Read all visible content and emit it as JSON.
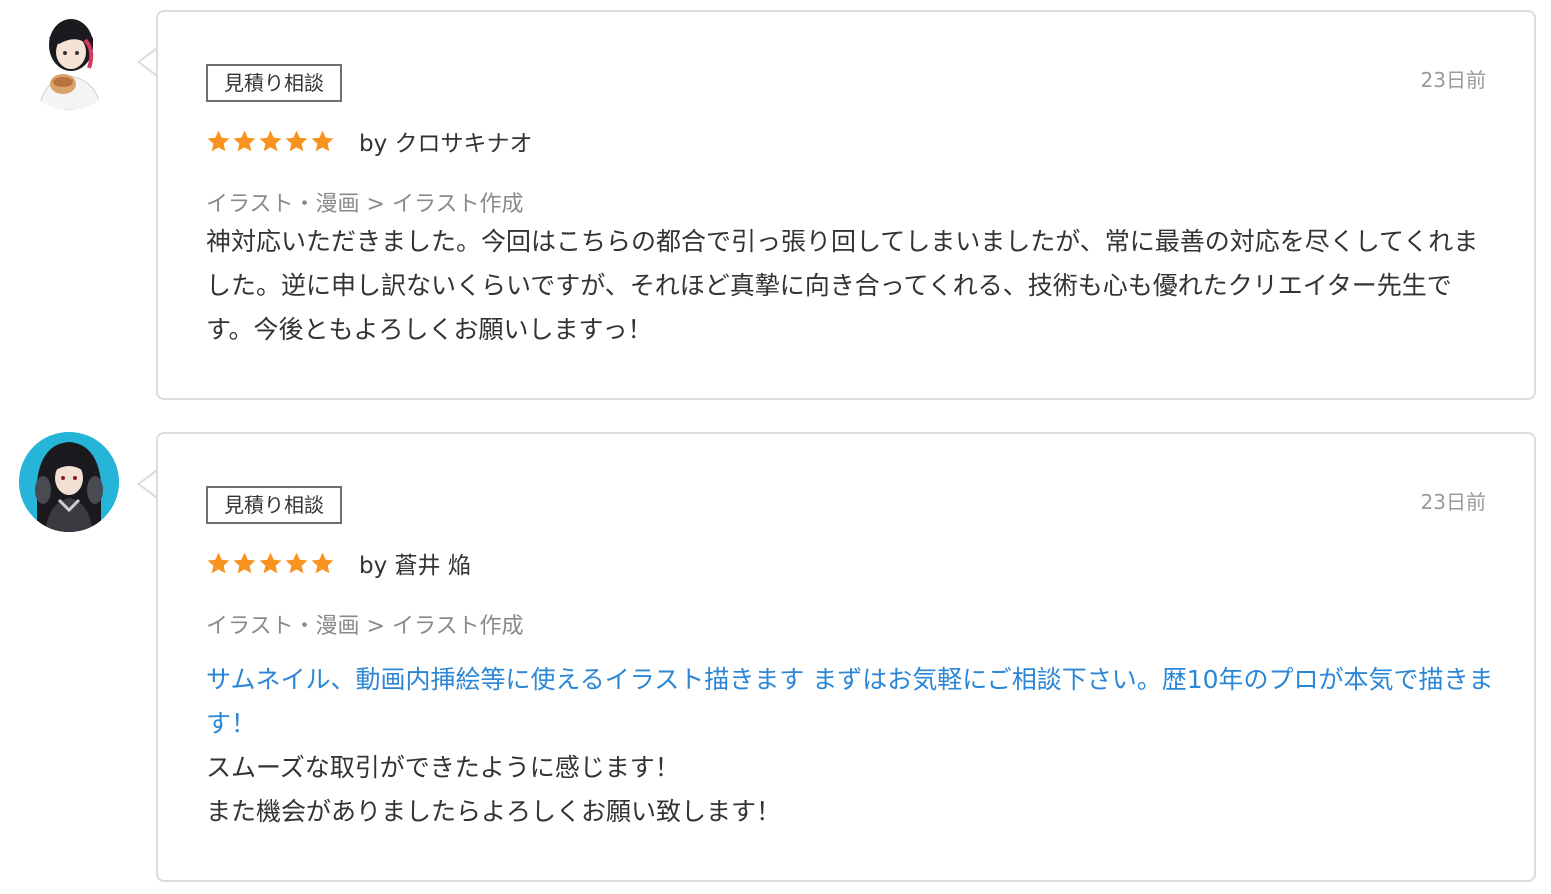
{
  "reviews": [
    {
      "tag": "見積り相談",
      "date": "23日前",
      "rating": 5,
      "byline": "by クロサキナオ",
      "category": "イラスト・漫画 > イラスト作成",
      "service_link": "",
      "comment": "神対応いただきました。今回はこちらの都合で引っ張り回してしまいましたが、常に最善の対応を尽くしてくれました。逆に申し訳ないくらいですが、それほど真摯に向き合ってくれる、技術も心も優れたクリエイター先生です。今後ともよろしくお願いしますっ！",
      "star_color": "#f7931e"
    },
    {
      "tag": "見積り相談",
      "date": "23日前",
      "rating": 5,
      "byline": "by 蒼井 焔",
      "category": "イラスト・漫画 > イラスト作成",
      "service_link": "サムネイル、動画内挿絵等に使えるイラスト描きます まずはお気軽にご相談下さい。歴10年のプロが本気で描きます！",
      "comment": "スムーズな取引ができたように感じます！\nまた機会がありましたらよろしくお願い致します！",
      "star_color": "#f7931e"
    }
  ]
}
